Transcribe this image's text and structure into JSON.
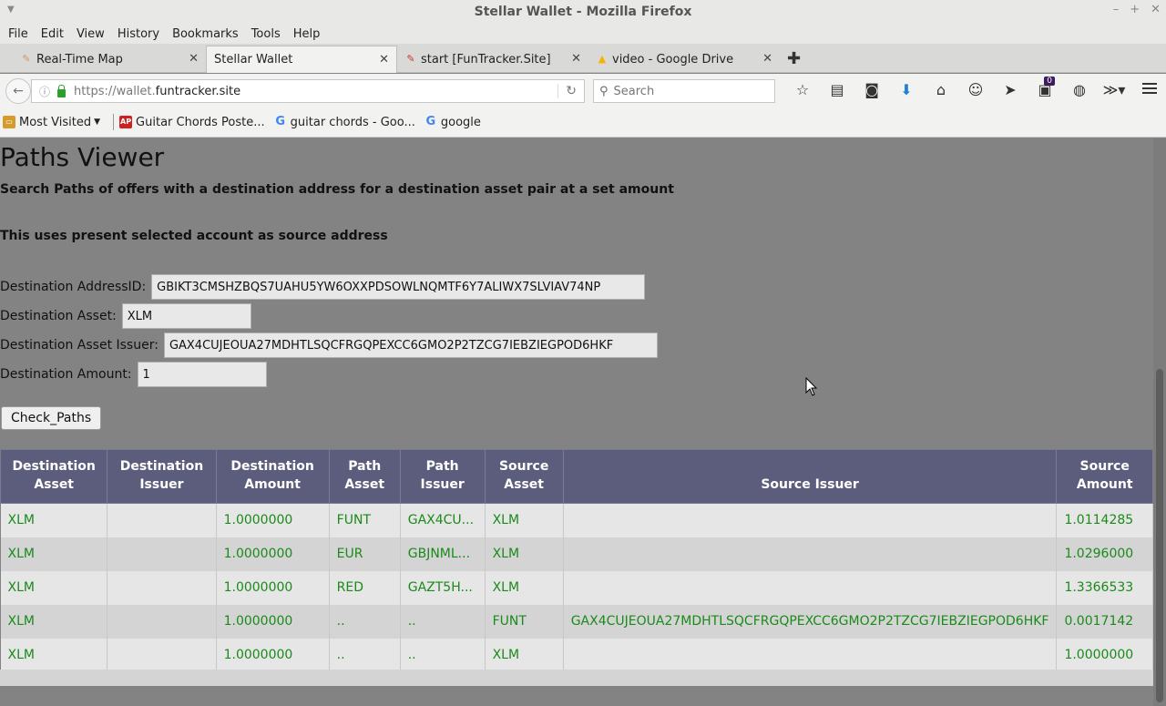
{
  "window": {
    "title": "Stellar Wallet - Mozilla Firefox"
  },
  "menu": [
    "File",
    "Edit",
    "View",
    "History",
    "Bookmarks",
    "Tools",
    "Help"
  ],
  "tabs": [
    {
      "label": "Real-Time Map",
      "icon": "map-favicon-icon"
    },
    {
      "label": "Stellar Wallet",
      "icon": "none",
      "active": true
    },
    {
      "label": "start [FunTracker.Site]",
      "icon": "pen-favicon-icon"
    },
    {
      "label": "video - Google Drive",
      "icon": "google-drive-icon"
    }
  ],
  "nav": {
    "url_prefix": "https://wallet.",
    "url_domain": "funtracker.site",
    "search_placeholder": "Search",
    "badge_count": "0"
  },
  "bookmarks": [
    {
      "label": "Most Visited",
      "icon": "folder-icon"
    },
    {
      "label": "Guitar Chords Poste...",
      "icon": "ap-icon"
    },
    {
      "label": "guitar chords - Goo...",
      "icon": "google-icon"
    },
    {
      "label": "google",
      "icon": "google-icon"
    }
  ],
  "page": {
    "title": "Paths Viewer",
    "description1": "Search Paths of offers with a destination address for a destination asset pair at a set amount",
    "description2": "This uses present selected account as source address",
    "fields": {
      "dest_address_label": "Destination AddressID:",
      "dest_address_value": "GBIKT3CMSHZBQS7UAHU5YW6OXXPDSOWLNQMTF6Y7ALIWX7SLVIAV74NP",
      "dest_asset_label": "Destination Asset:",
      "dest_asset_value": "XLM",
      "dest_issuer_label": "Destination Asset Issuer:",
      "dest_issuer_value": "GAX4CUJEOUA27MDHTLSQCFRGQPEXCC6GMO2P2TZCG7IEBZIEGPOD6HKF",
      "dest_amount_label": "Destination Amount:",
      "dest_amount_value": "1"
    },
    "button": "Check_Paths",
    "table": {
      "headers": [
        "Destination Asset",
        "Destination Issuer",
        "Destination Amount",
        "Path Asset",
        "Path Issuer",
        "Source Asset",
        "Source Issuer",
        "Source Amount"
      ],
      "rows": [
        [
          "XLM",
          "",
          "1.0000000",
          "FUNT",
          "GAX4CU...",
          "XLM",
          "",
          "1.0114285"
        ],
        [
          "XLM",
          "",
          "1.0000000",
          "EUR",
          "GBJNML...",
          "XLM",
          "",
          "1.0296000"
        ],
        [
          "XLM",
          "",
          "1.0000000",
          "RED",
          "GAZT5H...",
          "XLM",
          "",
          "1.3366533"
        ],
        [
          "XLM",
          "",
          "1.0000000",
          "..",
          "..",
          "FUNT",
          "GAX4CUJEOUA27MDHTLSQCFRGQPEXCC6GMO2P2TZCG7IEBZIEGPOD6HKF",
          "0.0017142"
        ],
        [
          "XLM",
          "",
          "1.0000000",
          "..",
          "..",
          "XLM",
          "",
          "1.0000000"
        ]
      ]
    }
  },
  "colors": {
    "table_header": "#5c5d7c",
    "cell_text": "#1a8a1a",
    "page_bg": "#838383"
  }
}
